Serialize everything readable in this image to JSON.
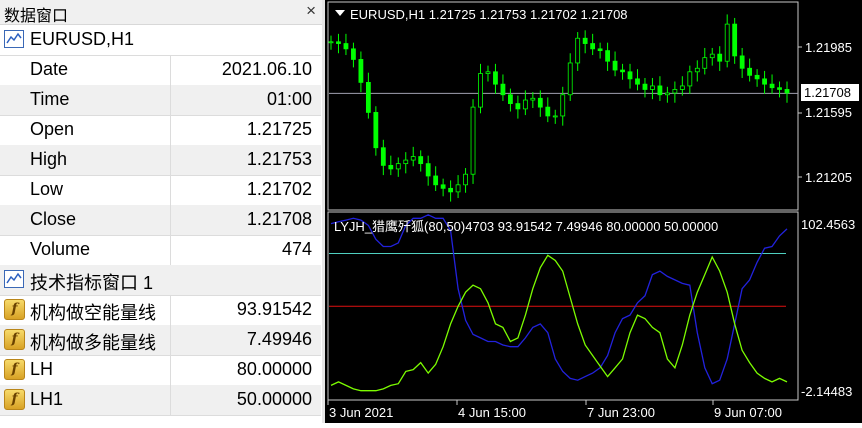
{
  "data_window": {
    "title": "数据窗口",
    "close_symbol": "×",
    "symbol_header": "EURUSD,H1",
    "rows": [
      {
        "label": "Date",
        "value": "2021.06.10"
      },
      {
        "label": "Time",
        "value": "01:00"
      },
      {
        "label": "Open",
        "value": "1.21725"
      },
      {
        "label": "High",
        "value": "1.21753"
      },
      {
        "label": "Low",
        "value": "1.21702"
      },
      {
        "label": "Close",
        "value": "1.21708"
      },
      {
        "label": "Volume",
        "value": "474"
      }
    ],
    "indicator_header": "技术指标窗口 1",
    "indicator_rows": [
      {
        "label": "机构做空能量线",
        "value": "93.91542"
      },
      {
        "label": "机构做多能量线",
        "value": "7.49946"
      },
      {
        "label": "LH",
        "value": "80.00000"
      },
      {
        "label": "LH1",
        "value": "50.00000"
      }
    ]
  },
  "chart": {
    "header": "EURUSD,H1  1.21725 1.21753 1.21702 1.21708",
    "price_ticks": [
      "1.21985",
      "1.21595",
      "1.21205"
    ],
    "current_price": "1.21708",
    "indicator_header": "LYJH_猎鹰歼狐(80,50)4703 93.91542 7.49946 80.00000 50.00000",
    "indicator_max": "102.4563",
    "indicator_min": "-2.14483",
    "time_labels": [
      "3 Jun 2021",
      "4 Jun 15:00",
      "7 Jun 23:00",
      "9 Jun 07:00"
    ],
    "colors": {
      "background": "#000000",
      "candles": "#00ff00",
      "line_short": "#2222dd",
      "line_long": "#7cfc00",
      "level_80": "#4fd0c0",
      "level_50": "#e01010",
      "price_line": "#a0a0b0"
    }
  },
  "chart_data": [
    {
      "type": "line",
      "title": "EURUSD,H1  1.21725 1.21753 1.21702 1.21708",
      "ylim": [
        1.2107,
        1.2218
      ],
      "y_ticks": [
        1.21985,
        1.21595,
        1.21205
      ],
      "x_tick_labels": [
        "3 Jun 2021",
        "4 Jun 15:00",
        "7 Jun 23:00",
        "9 Jun 07:00"
      ],
      "current_price": 1.21708,
      "series": [
        {
          "values": [
            1.22,
            1.2199,
            1.2196,
            1.219,
            1.2177,
            1.216,
            1.214,
            1.213,
            1.2128,
            1.2131,
            1.2133,
            1.2135,
            1.2131,
            1.2124,
            1.2119,
            1.2117,
            1.2115,
            1.2119,
            1.2125,
            1.2163,
            1.2182,
            1.2183,
            1.2176,
            1.217,
            1.2165,
            1.2162,
            1.2167,
            1.2168,
            1.2163,
            1.2158,
            1.2158,
            1.217,
            1.2188,
            1.2202,
            1.2199,
            1.2196,
            1.2195,
            1.2189,
            1.2184,
            1.2183,
            1.2179,
            1.2176,
            1.2173,
            1.2175,
            1.217,
            1.2171,
            1.2173,
            1.2175,
            1.2183,
            1.2185,
            1.2191,
            1.2193,
            1.2189,
            1.221,
            1.2192,
            1.2185,
            1.2181,
            1.2179,
            1.2176,
            1.2174,
            1.2173,
            1.2171
          ]
        }
      ]
    },
    {
      "type": "line",
      "title": "LYJH_猎鹰歼狐(80,50)4703 93.91542 7.49946 80.00000 50.00000",
      "ylim": [
        -2.14483,
        102.4563
      ],
      "x_tick_labels": [
        "3 Jun 2021",
        "4 Jun 15:00",
        "7 Jun 23:00",
        "9 Jun 07:00"
      ],
      "series": [
        {
          "name": "机构做空能量线",
          "values": [
            97,
            98,
            99,
            100,
            99,
            96,
            88,
            84,
            84,
            86,
            96,
            100,
            100,
            102,
            100,
            100,
            93,
            60,
            42,
            34,
            32,
            30,
            30,
            28,
            27,
            27,
            32,
            38,
            40,
            35,
            20,
            13,
            9,
            8,
            10,
            12,
            15,
            22,
            35,
            43,
            45,
            52,
            56,
            68,
            70,
            67,
            65,
            63,
            62,
            35,
            15,
            6,
            8,
            20,
            40,
            60,
            65,
            75,
            83,
            84,
            90,
            94
          ]
        },
        {
          "name": "机构做多能量线",
          "values": [
            5,
            7,
            5,
            3,
            2,
            2,
            2,
            3,
            5,
            6,
            13,
            14,
            18,
            12,
            17,
            27,
            40,
            50,
            58,
            62,
            60,
            52,
            40,
            38,
            30,
            32,
            45,
            60,
            72,
            79,
            76,
            70,
            55,
            40,
            28,
            22,
            16,
            10,
            15,
            20,
            35,
            45,
            43,
            38,
            35,
            20,
            15,
            28,
            45,
            58,
            68,
            78,
            70,
            58,
            40,
            25,
            18,
            12,
            9,
            7,
            9,
            7
          ]
        },
        {
          "name": "LH",
          "values": [
            80,
            80
          ]
        },
        {
          "name": "LH1",
          "values": [
            50,
            50
          ]
        }
      ]
    }
  ]
}
